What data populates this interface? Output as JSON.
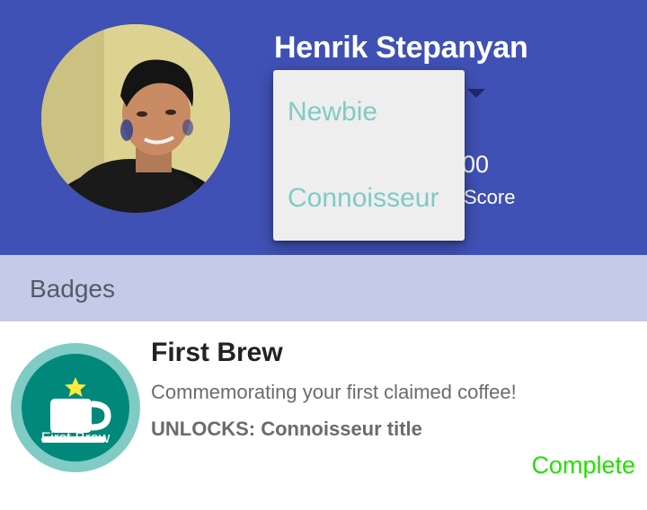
{
  "profile": {
    "name": "Henrik Stepanyan",
    "score_value": "00",
    "score_label": "Score"
  },
  "title_menu": {
    "options": [
      "Newbie",
      "Connoisseur"
    ],
    "option_color": "#80cbc4"
  },
  "sections": {
    "badges_title": "Badges"
  },
  "badges": [
    {
      "icon_name": "coffee-cup-icon",
      "icon_label": "First Brew",
      "name": "First Brew",
      "description": "Commemorating your first claimed coffee!",
      "unlocks": "UNLOCKS: Connoisseur title",
      "status": "Complete"
    }
  ],
  "colors": {
    "header": "#3f51b5",
    "section_bar": "#c5cae9",
    "badge_teal": "#00897b",
    "badge_ring": "#80cbc4",
    "status_complete": "#22e000"
  }
}
